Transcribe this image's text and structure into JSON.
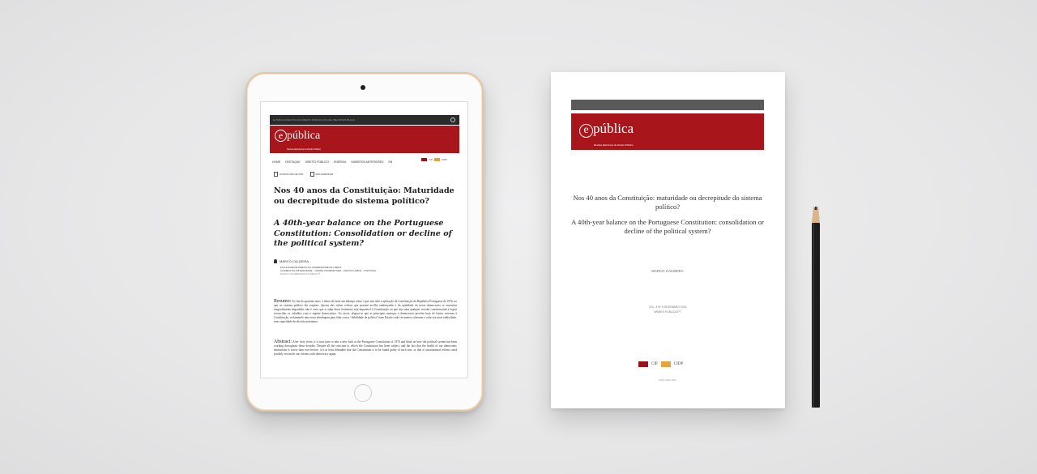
{
  "tablet": {
    "topbar_text": "E-PUBLICA REVISTA DE DIREITO PÚBLICO ONLINE (REVISTAPUBLICA)",
    "logo": {
      "e": "e",
      "name": "pública",
      "tagline": "Revista Eletrónica de Direito Público"
    },
    "nav": [
      "HOME",
      "DESTAQUE",
      "DIREITO PÚBLICO",
      "ENERGIA",
      "NÚMEROS ANTERIORES",
      "EN"
    ],
    "logos": [
      "CIP",
      "CIDP"
    ],
    "actions": {
      "download": "DOWNLOAD DE PDF",
      "recommend": "RECOMENDAR"
    },
    "title": "Nos 40 anos da Constituição: Maturidade ou decrepitude do sistema político?",
    "subtitle": "A 40th-year balance on the Portuguese Constitution: Consolidation or decline of the political system?",
    "author": "MARCO CALDEIRA",
    "affiliation": [
      "FACULDADE DE DIREITO DA UNIVERSIDADE DE LISBOA",
      "ALAMEDA DA UNIVERSIDADE – CIDADE UNIVERSITÁRIA · 1649-014 LISBOA – PORTUGAL",
      "MARCO.CALDEIRA@FD.ULISBOA.PT"
    ],
    "abstract_pt": {
      "heading": "Resumo:",
      "text": "Ao fim de quarenta anos, é altura de fazer um balanço sobre o que tem sido a aplicação da Constituição da República Portuguesa de 1976, no que ao sistema político diz respeito. Apesar das várias críticas que possam ser-lhe endereçadas e da qualidade da nossa democracia se encontrar inegavelmente degradada, não é certo que a culpa desse fenómeno seja imputável à Constituição ou que seja uma qualquer revisão constitucional a lograr reconciliar os cidadãos com o regime democrático. Ao invés, afigura-se que as principais ameaças à democracia provêm hoje de fontes externas à Constituição, reclamando uma nova abordagem para falar com a “debilidade da política” num Estado cada vez menos soberano e cada vez mais endividado, sem capacidade de decisão autónoma."
    },
    "abstract_en": {
      "heading": "Abstract:",
      "text": "After forty years, it is now time to take a new look at the Portuguese Constitution of 1976 and think on how the political system has been working throughout these decades. Despite all the criticism to which the Constitution has been subject, and the fact that the health of our democratic institutions is worse than ever before, it is at least debatable that the Constitution is to be found guilty of such sins, or that a constitutional reform could possibly reconcile our citizens with democracy again."
    }
  },
  "paper": {
    "logo": {
      "e": "e",
      "name": "pública",
      "tagline": "Revista Eletrónica de Direito Público"
    },
    "title": "Nos 40 anos da Constituição: maturidade ou decrepitude do sistema político?",
    "subtitle": "A 40th-year balance on the Portuguese Constitution: consolidation or decline of the political system?",
    "author": "MARCO CALDEIRA",
    "volume": "VOL. 3 Nº 3 DEZEMBRO 2016",
    "website": "WWW.E-PUBLICA.PT",
    "logos": [
      "CIP",
      "CIDP"
    ],
    "issn": "ISSN 2183-184x"
  },
  "colors": {
    "brand_red": "#a8151b",
    "dark_bar": "#2b2b2b",
    "gold": "#e6a23c"
  }
}
